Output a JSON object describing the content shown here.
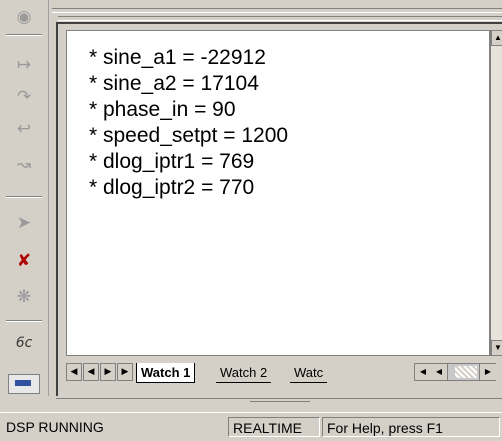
{
  "watch": {
    "lines": [
      "* sine_a1 = -22912",
      "* sine_a2 = 17104",
      "* phase_in = 90",
      "* speed_setpt = 1200",
      "* dlog_iptr1 = 769",
      "* dlog_iptr2 = 770"
    ],
    "tabs": [
      "Watch 1",
      "Watch 2",
      "Watc"
    ]
  },
  "toolbar": {
    "icons": [
      "glasses-icon",
      "step-into-icon",
      "step-over-icon",
      "step-out-icon",
      "run-to-cursor-icon",
      "run-icon",
      "running-man-icon",
      "animate-icon",
      "view-code-icon",
      "watch-window-icon"
    ],
    "view_code_glyph": "6c"
  },
  "status": {
    "state": "DSP RUNNING",
    "mode": "REALTIME",
    "help": "For Help, press F1"
  }
}
